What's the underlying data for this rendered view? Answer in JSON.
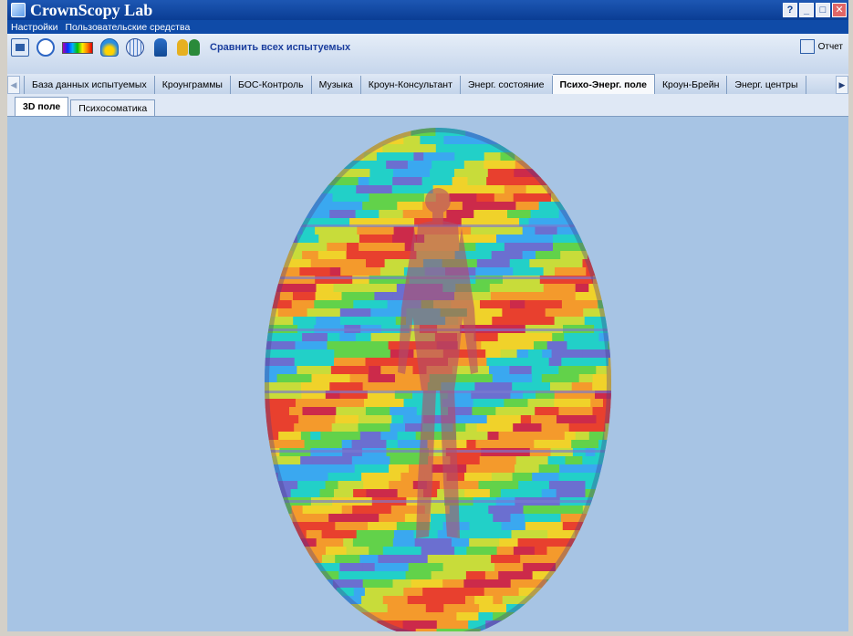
{
  "app": {
    "title": "CrownScopy Lab"
  },
  "window_buttons": {
    "help": "?",
    "minimize": "_",
    "maximize": "□",
    "close": "✕"
  },
  "menu": {
    "items": [
      "Настройки",
      "Пользовательские средства"
    ]
  },
  "toolbar": {
    "compare_label": "Сравнить всех испытуемых",
    "report_label": "Отчет"
  },
  "main_tabs": {
    "active_index": 6,
    "items": [
      "База данных испытуемых",
      "Кроунграммы",
      "БОС-Контроль",
      "Музыка",
      "Кроун-Консультант",
      "Энерг. состояние",
      "Психо-Энерг. поле",
      "Кроун-Брейн",
      "Энерг. центры"
    ]
  },
  "sub_tabs": {
    "active_index": 0,
    "items": [
      "3D поле",
      "Психосоматика"
    ]
  },
  "viewer": {
    "palette": [
      "#6b6fd0",
      "#3aa8f0",
      "#22d0c8",
      "#62d24a",
      "#c8dc3a",
      "#f0d22a",
      "#f49a2c",
      "#e8402e",
      "#cc2a4a"
    ],
    "figure_color": "#b0506a"
  }
}
